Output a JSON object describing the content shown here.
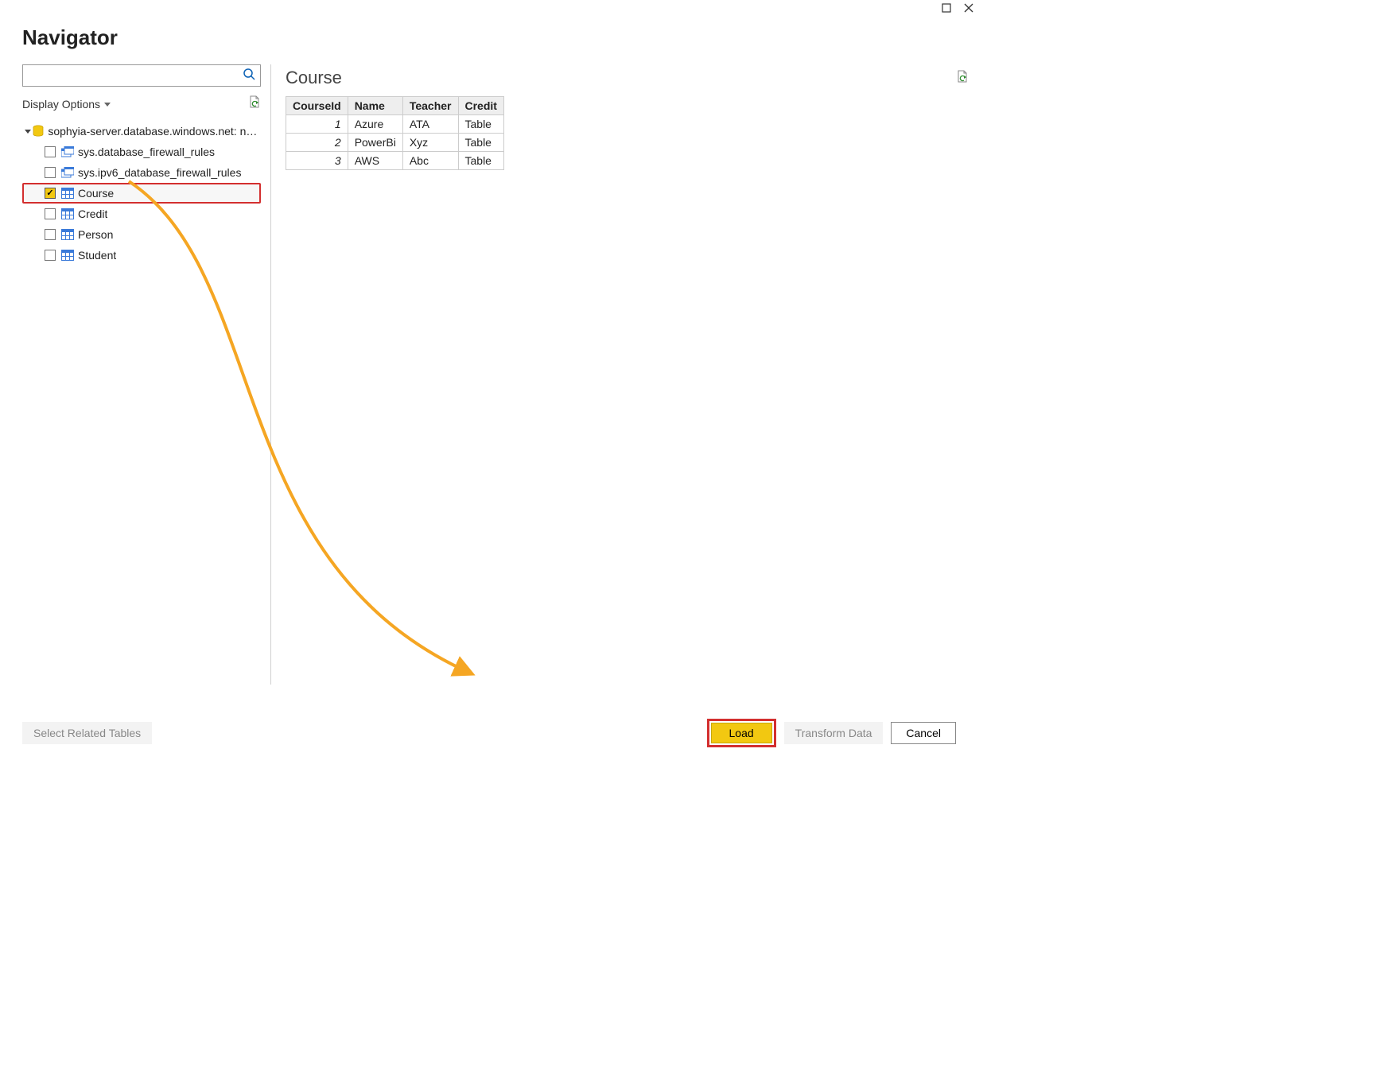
{
  "window": {
    "title": "Navigator",
    "display_options_label": "Display Options",
    "search_placeholder": ""
  },
  "tree": {
    "root_label": "sophyia-server.database.windows.net: new-dat…",
    "items": [
      {
        "label": "sys.database_firewall_rules",
        "icon": "view",
        "checked": false
      },
      {
        "label": "sys.ipv6_database_firewall_rules",
        "icon": "view",
        "checked": false
      },
      {
        "label": "Course",
        "icon": "table",
        "checked": true,
        "highlighted": true
      },
      {
        "label": "Credit",
        "icon": "table",
        "checked": false
      },
      {
        "label": "Person",
        "icon": "table",
        "checked": false
      },
      {
        "label": "Student",
        "icon": "table",
        "checked": false
      }
    ]
  },
  "preview": {
    "title": "Course",
    "columns": [
      "CourseId",
      "Name",
      "Teacher",
      "Credit"
    ],
    "rows": [
      {
        "CourseId": "1",
        "Name": "Azure",
        "Teacher": "ATA",
        "Credit": "Table"
      },
      {
        "CourseId": "2",
        "Name": "PowerBi",
        "Teacher": "Xyz",
        "Credit": "Table"
      },
      {
        "CourseId": "3",
        "Name": "AWS",
        "Teacher": "Abc",
        "Credit": "Table"
      }
    ]
  },
  "footer": {
    "select_related": "Select Related Tables",
    "load": "Load",
    "transform": "Transform Data",
    "cancel": "Cancel"
  }
}
